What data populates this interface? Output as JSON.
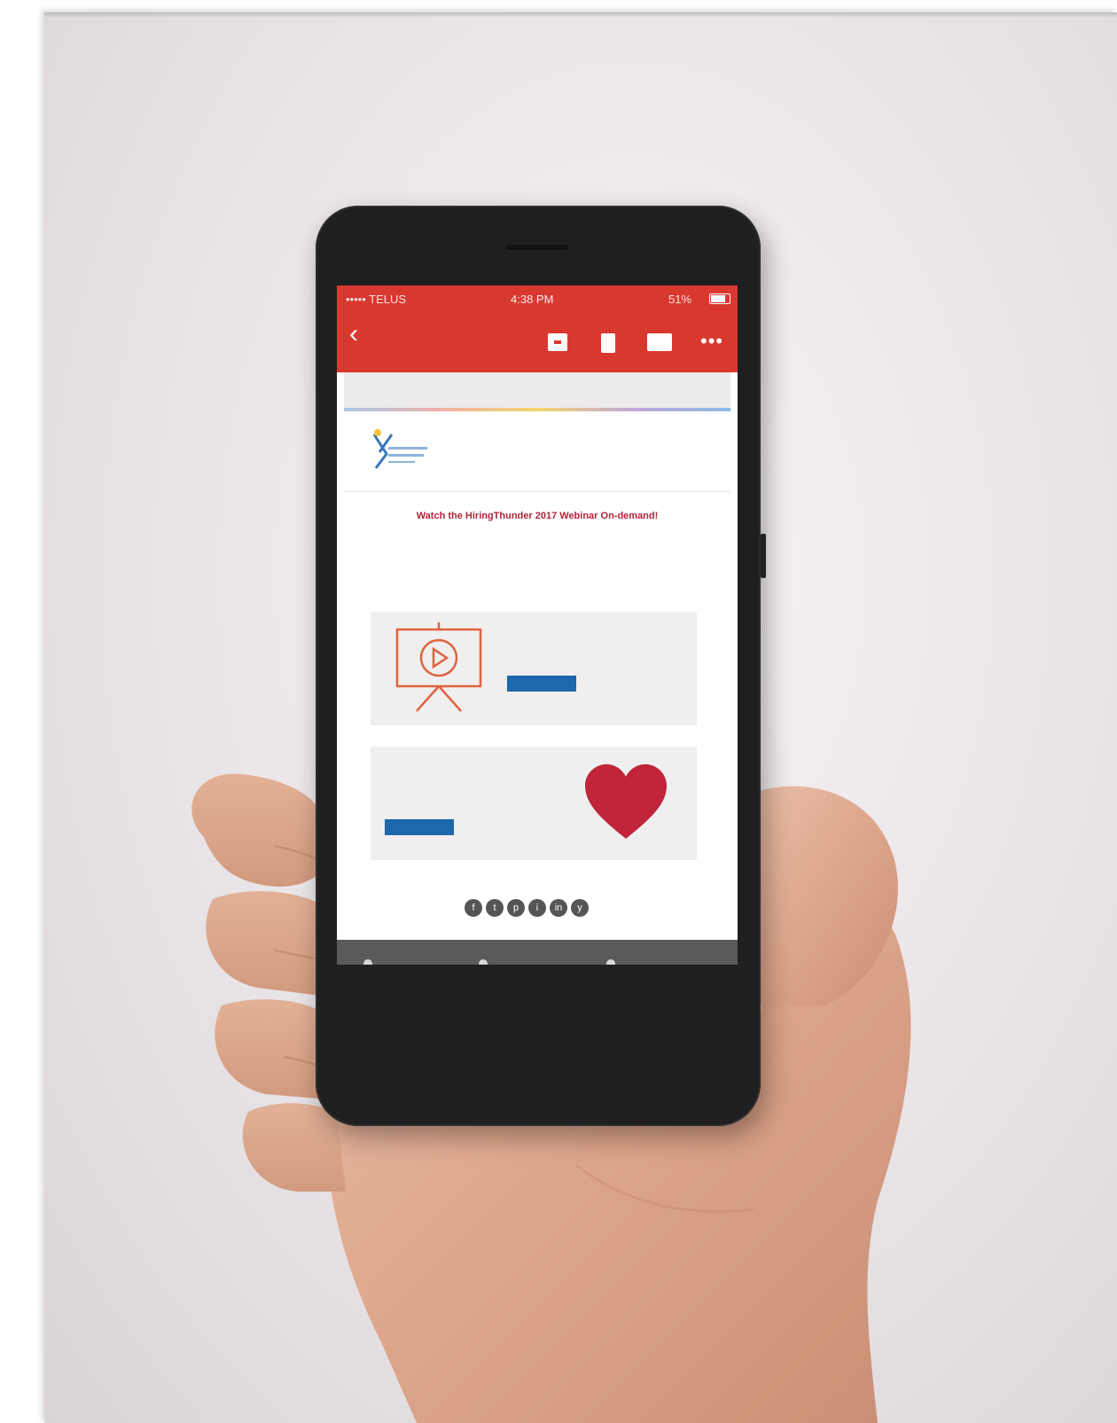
{
  "phone": {
    "status": {
      "carrier": "••••• TELUS",
      "time": "4:38 PM",
      "battery": "51%"
    },
    "toolbar": {
      "back_icon": "chevron-left-icon",
      "archive_icon": "archive-icon",
      "trash_icon": "trash-icon",
      "mail_icon": "mail-icon",
      "more_icon": "more-icon"
    }
  },
  "email": {
    "headline": "Watch the HiringThunder 2017 Webinar On-demand!",
    "buttons": {
      "card1": "",
      "card2": ""
    }
  },
  "colors": {
    "appbar": "#d9382f",
    "accent": "#c2283d",
    "button": "#1e67ad"
  }
}
